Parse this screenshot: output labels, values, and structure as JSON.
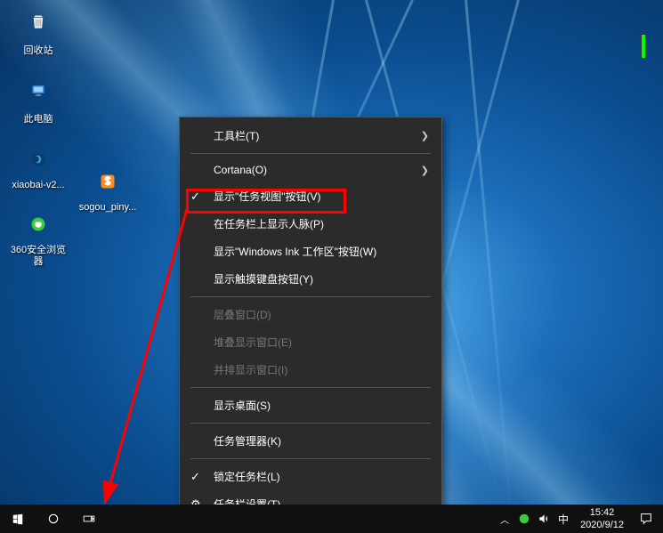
{
  "desktop_icons": {
    "recycle": "回收站",
    "this_pc": "此电脑",
    "xiaobai": "xiaobai-v2...",
    "sogou": "sogou_piny...",
    "browser360": "360安全浏览器"
  },
  "context_menu": {
    "toolbars": "工具栏(T)",
    "cortana": "Cortana(O)",
    "show_taskview": "显示\"任务视图\"按钮(V)",
    "show_people": "在任务栏上显示人脉(P)",
    "show_ink": "显示\"Windows Ink 工作区\"按钮(W)",
    "show_touch_kb": "显示触摸键盘按钮(Y)",
    "cascade": "层叠窗口(D)",
    "stacked": "堆叠显示窗口(E)",
    "sidebyside": "并排显示窗口(I)",
    "show_desktop": "显示桌面(S)",
    "task_manager": "任务管理器(K)",
    "lock_taskbar": "锁定任务栏(L)",
    "taskbar_settings": "任务栏设置(T)"
  },
  "tray": {
    "ime": "中",
    "time": "15:42",
    "date": "2020/9/12"
  }
}
